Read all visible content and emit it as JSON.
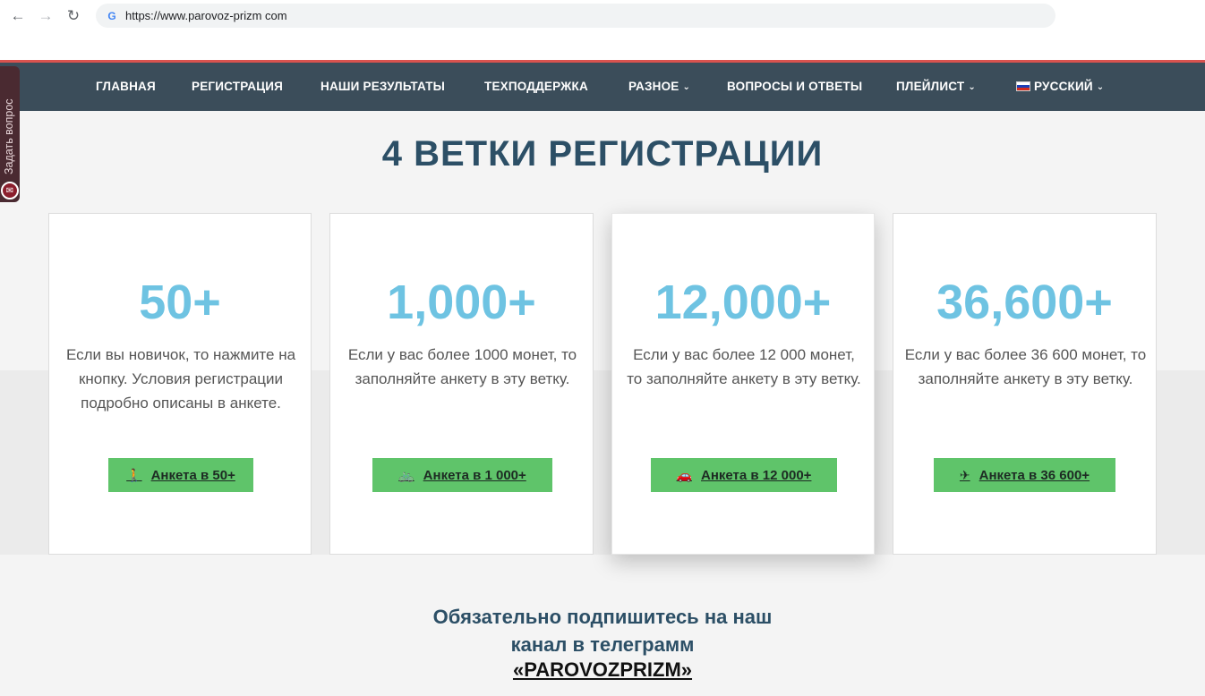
{
  "browser": {
    "back_icon": "←",
    "forward_icon": "→",
    "reload_icon": "↻",
    "url": "https://www.parovoz-prizm com"
  },
  "nav": {
    "items": [
      {
        "label": "ГЛАВНАЯ"
      },
      {
        "label": "РЕГИСТРАЦИЯ"
      },
      {
        "label": "НАШИ РЕЗУЛЬТАТЫ"
      },
      {
        "label": "ТЕХПОДДЕРЖКА"
      },
      {
        "label": "РАЗНОЕ"
      },
      {
        "label": "ВОПРОСЫ И ОТВЕТЫ"
      },
      {
        "label": "ПЛЕЙЛИСТ"
      },
      {
        "label": "РУССКИЙ"
      }
    ],
    "caret": "⌄"
  },
  "side_tab": {
    "label": "Задать вопрос",
    "icon": "mail-icon"
  },
  "title": "4 ВЕТКИ РЕГИСТРАЦИИ",
  "cards": [
    {
      "number": "50+",
      "description": "Если вы новичок, то нажмите на кнопку. Условия регистрации подробно описаны в анкете.",
      "button_label": "Анкета в 50+",
      "icon": "walking-icon",
      "icon_glyph": "🚶"
    },
    {
      "number": "1,000+",
      "description": "Если у вас более 1000 монет, то заполняйте анкету в эту ветку.",
      "button_label": "Анкета в 1 000+",
      "icon": "bicycle-icon",
      "icon_glyph": "🚲"
    },
    {
      "number": "12,000+",
      "description": "Если у вас более 12 000 монет, то заполняйте анкету в эту ветку.",
      "button_label": "Анкета в 12 000+",
      "icon": "car-icon",
      "icon_glyph": "🚗"
    },
    {
      "number": "36,600+",
      "description": "Если у вас более 36 600 монет, то заполняйте анкету в эту ветку.",
      "button_label": "Анкета в 36 600+",
      "icon": "plane-icon",
      "icon_glyph": "✈"
    }
  ],
  "subscribe": {
    "line1": "Обязательно подпишитесь на наш",
    "line2": "канал в телеграмм",
    "link": "«PAROVOZPRIZM»"
  }
}
